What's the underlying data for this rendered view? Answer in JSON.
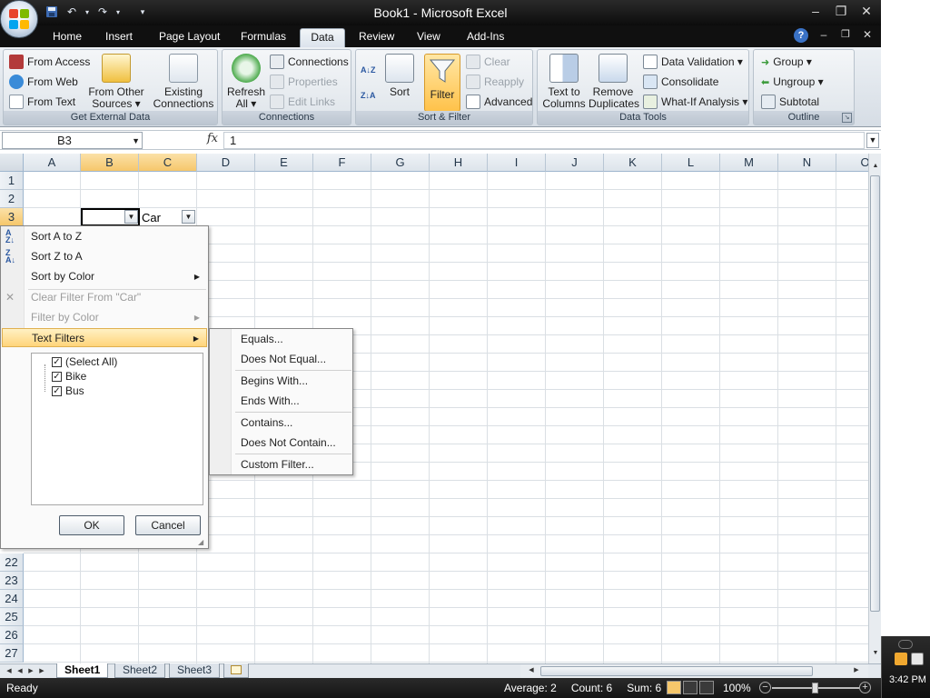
{
  "window": {
    "title": "Book1 - Microsoft Excel",
    "controls": [
      "–",
      "❐",
      "✕"
    ],
    "doc_controls": [
      "–",
      "❐",
      "✕"
    ]
  },
  "quick_access": [
    "save-icon",
    "undo-icon",
    "redo-icon",
    "customize-icon"
  ],
  "tabs": [
    {
      "label": "Home"
    },
    {
      "label": "Insert"
    },
    {
      "label": "Page Layout"
    },
    {
      "label": "Formulas"
    },
    {
      "label": "Data",
      "active": true
    },
    {
      "label": "Review"
    },
    {
      "label": "View"
    },
    {
      "label": "Add-Ins"
    }
  ],
  "help_glyph": "?",
  "ribbon": {
    "external_data": {
      "label": "Get External Data",
      "from_access": "From Access",
      "from_web": "From Web",
      "from_text": "From Text",
      "from_other_1": "From Other",
      "from_other_2": "Sources ▾",
      "existing_1": "Existing",
      "existing_2": "Connections"
    },
    "connections": {
      "label": "Connections",
      "refresh_1": "Refresh",
      "refresh_2": "All ▾",
      "connections": "Connections",
      "properties": "Properties",
      "edit_links": "Edit Links"
    },
    "sort_filter": {
      "label": "Sort & Filter",
      "sort": "Sort",
      "filter": "Filter",
      "clear": "Clear",
      "reapply": "Reapply",
      "advanced": "Advanced",
      "az_glyph": "A↓Z",
      "za_glyph": "Z↓A"
    },
    "data_tools": {
      "label": "Data Tools",
      "text_to_columns_1": "Text to",
      "text_to_columns_2": "Columns",
      "remove_dup_1": "Remove",
      "remove_dup_2": "Duplicates",
      "data_validation": "Data Validation ▾",
      "consolidate": "Consolidate",
      "what_if": "What-If Analysis ▾"
    },
    "outline": {
      "label": "Outline",
      "group": "Group ▾",
      "ungroup": "Ungroup ▾",
      "subtotal": "Subtotal"
    }
  },
  "formula_bar": {
    "name_box": "B3",
    "fx": "fx",
    "value": "1"
  },
  "grid": {
    "columns": [
      "A",
      "B",
      "C",
      "D",
      "E",
      "F",
      "G",
      "H",
      "I",
      "J",
      "K",
      "L",
      "M",
      "N",
      "O"
    ],
    "rows_top": [
      "1",
      "2",
      "3"
    ],
    "rows_bottom": [
      "22",
      "23",
      "24",
      "25",
      "26",
      "27"
    ],
    "c3_value": "Car"
  },
  "filter_menu": {
    "sort_az": "Sort A to Z",
    "sort_za": "Sort Z to A",
    "sort_color": "Sort by Color",
    "clear_filter": "Clear Filter From \"Car\"",
    "filter_color": "Filter by Color",
    "text_filters": "Text Filters",
    "checklist": [
      {
        "label": "(Select All)",
        "checked": true
      },
      {
        "label": "Bike",
        "checked": true
      },
      {
        "label": "Bus",
        "checked": true
      }
    ],
    "ok": "OK",
    "cancel": "Cancel"
  },
  "text_filters_submenu": [
    "Equals...",
    "Does Not Equal...",
    "Begins With...",
    "Ends With...",
    "Contains...",
    "Does Not Contain...",
    "Custom Filter..."
  ],
  "sheets": [
    {
      "label": "Sheet1",
      "active": true
    },
    {
      "label": "Sheet2"
    },
    {
      "label": "Sheet3"
    }
  ],
  "status": {
    "ready": "Ready",
    "average": "Average: 2",
    "count": "Count: 6",
    "sum": "Sum: 6",
    "zoom": "100%",
    "zoom_minus": "−",
    "zoom_plus": "+"
  },
  "tray": {
    "clock": "3:42 PM"
  },
  "colors": {
    "accent_orange": "#f6c76b",
    "selection_border": "#000000",
    "office_blue": "#3a72c6"
  }
}
